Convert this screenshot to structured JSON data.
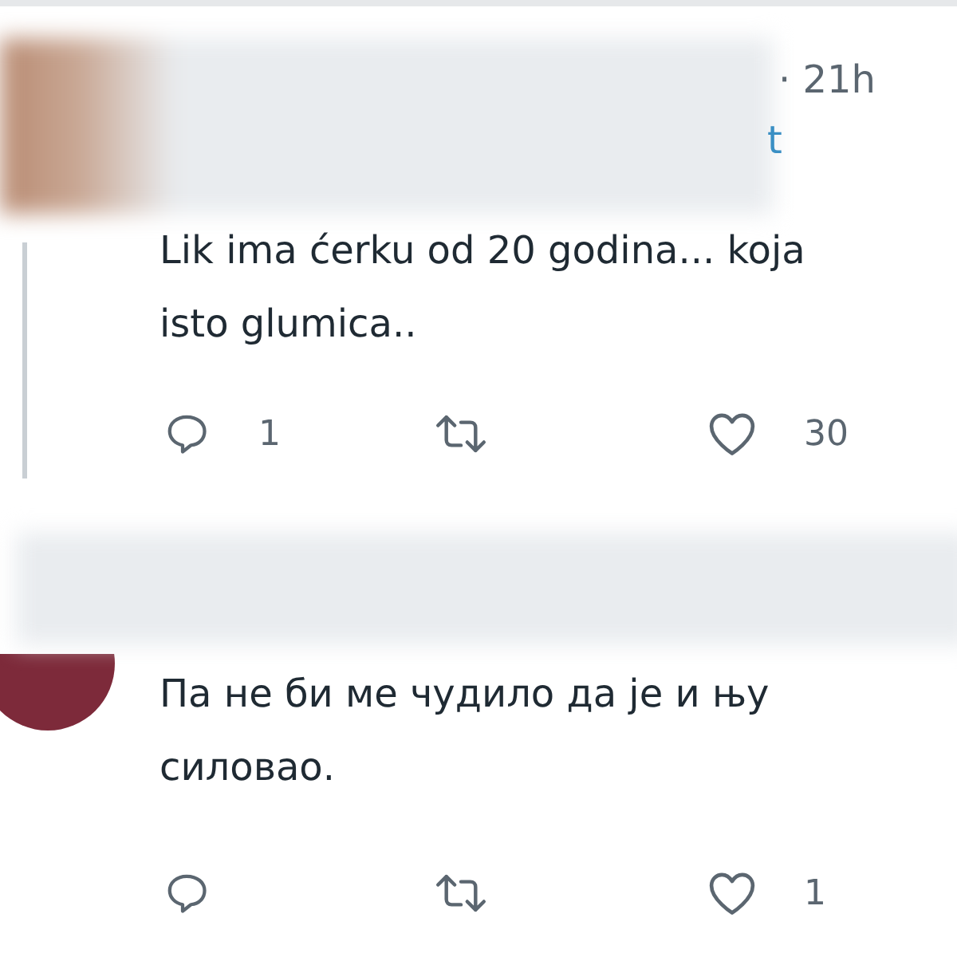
{
  "replies": [
    {
      "time": "· 21h",
      "extra": "t",
      "lines": [
        "Lik ima ćerku od 20 godina... koja",
        "isto glumica.."
      ],
      "thread_line": true,
      "reply_count": "1",
      "like_count": "30"
    },
    {
      "lines": [
        "Па не би ме чудило да је и њу",
        "силовао."
      ],
      "thread_line": false,
      "like_count": "1"
    }
  ]
}
